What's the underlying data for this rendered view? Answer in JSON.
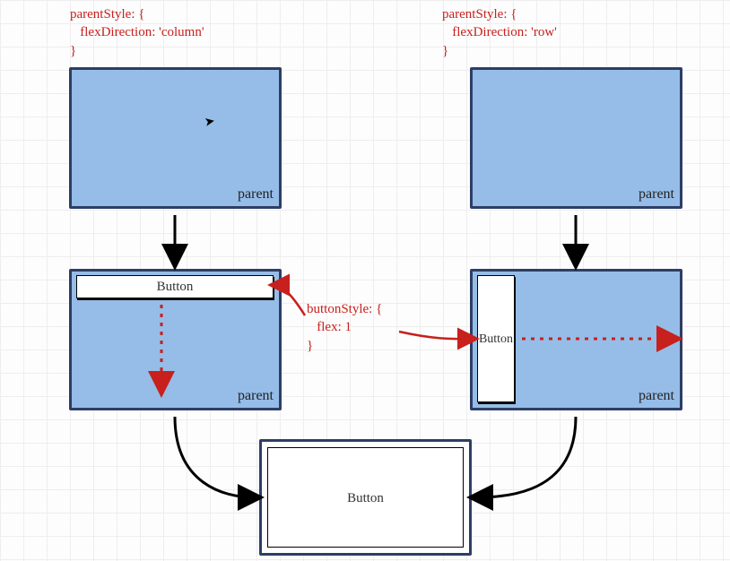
{
  "codeLeft": "parentStyle: {\n   flexDirection: 'column'\n}",
  "codeRight": "parentStyle: {\n   flexDirection: 'row'\n}",
  "codeMiddle": "buttonStyle: {\n   flex: 1\n}",
  "parentLabel": "parent",
  "buttonLabel": "Button"
}
